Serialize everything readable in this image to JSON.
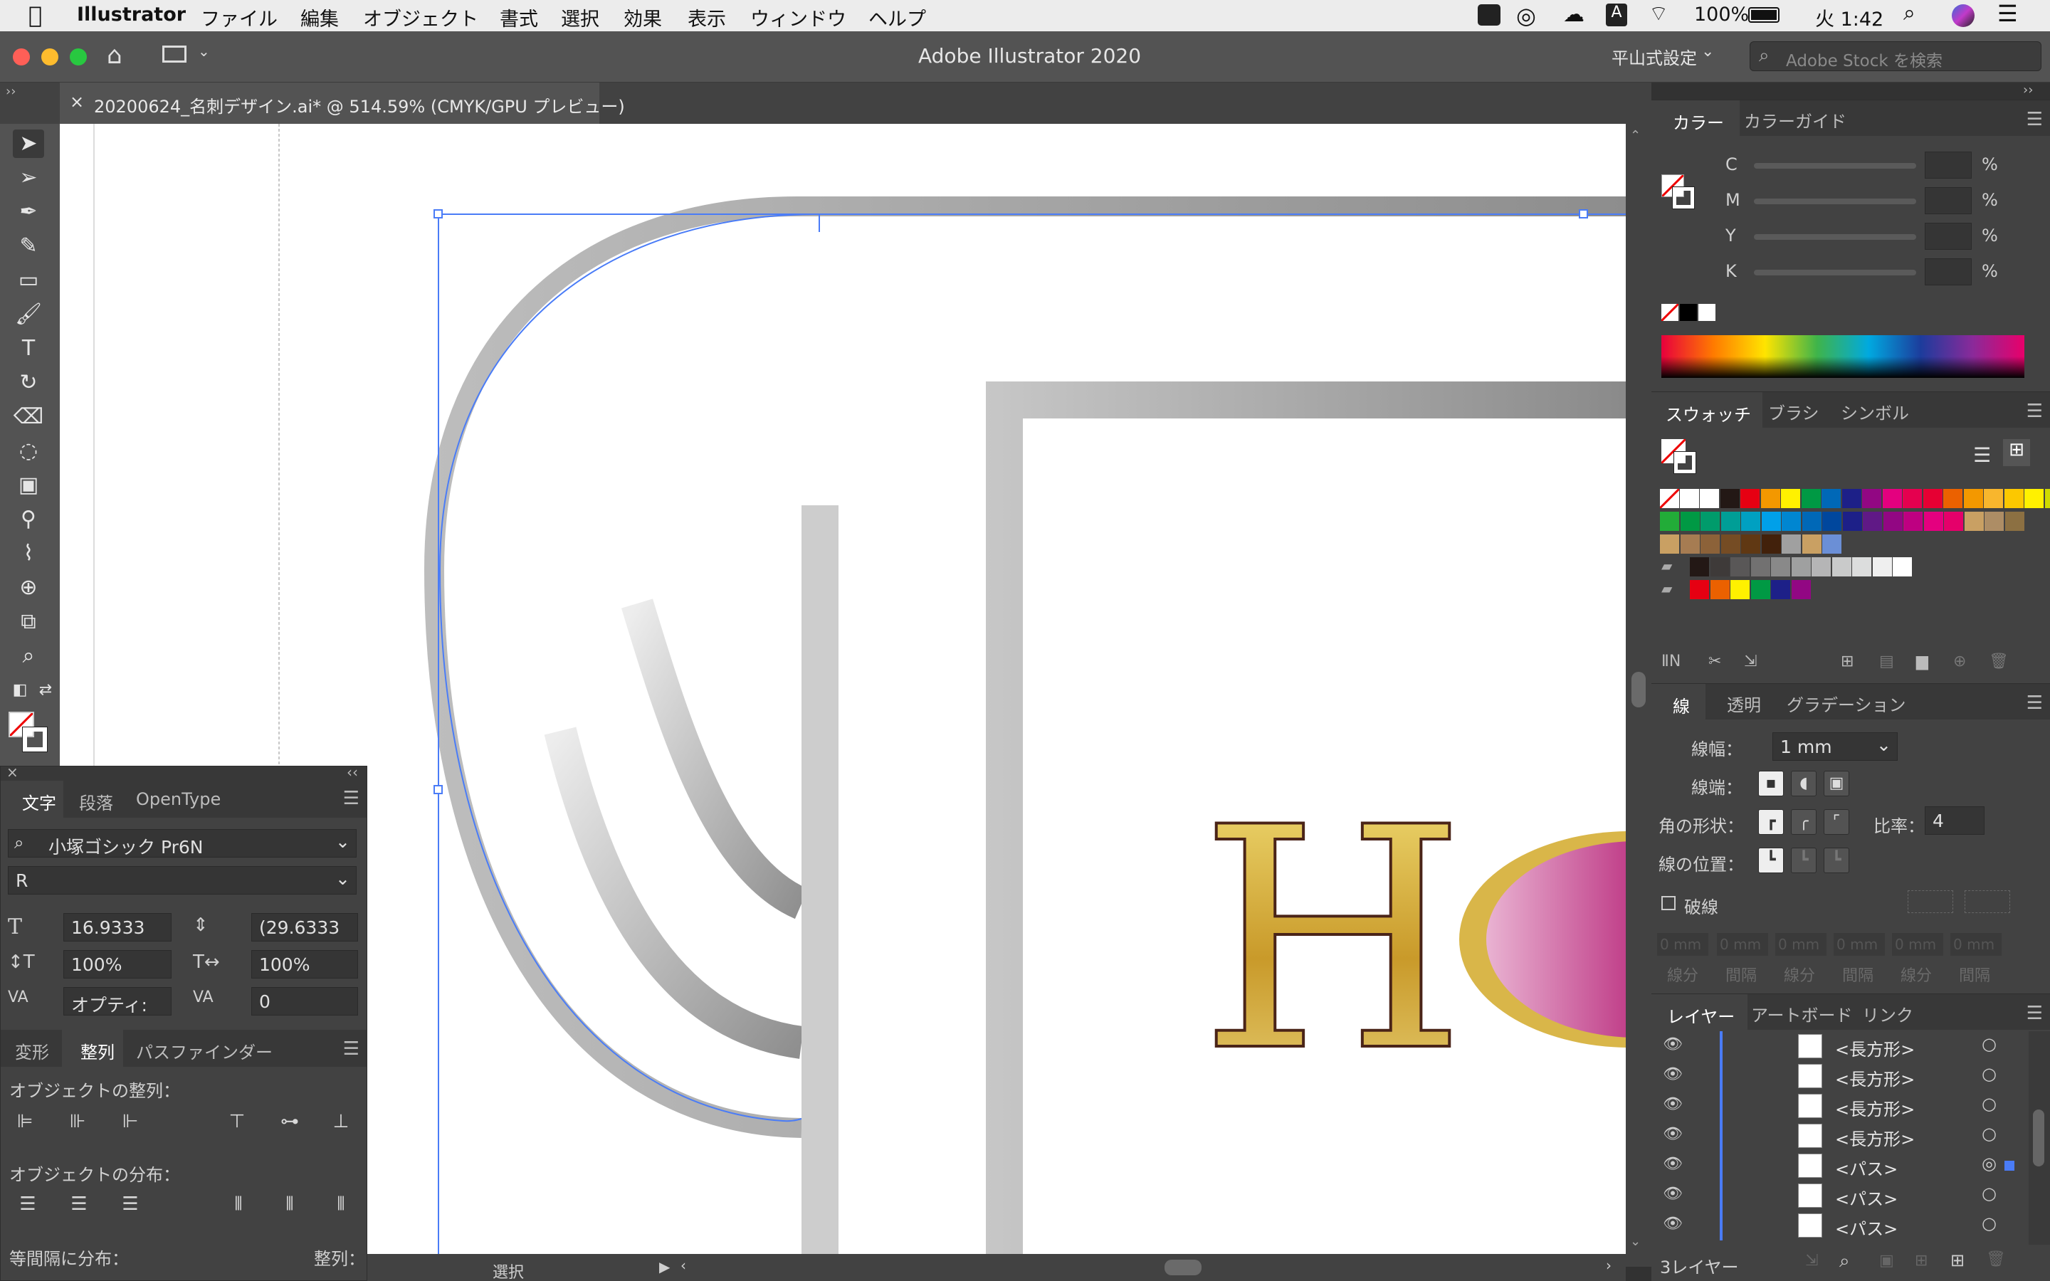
{
  "menubar": {
    "app": "Illustrator",
    "items": [
      "ファイル",
      "編集",
      "オブジェクト",
      "書式",
      "選択",
      "効果",
      "表示",
      "ウィンドウ",
      "ヘルプ"
    ],
    "battery": "100%",
    "clock": "火 1:42",
    "input_method": "A"
  },
  "window": {
    "title": "Adobe Illustrator 2020",
    "workspace": "平山式設定",
    "stock_placeholder": "Adobe Stock を検索"
  },
  "document": {
    "tab_title": "20200624_名刺デザイン.ai* @ 514.59% (CMYK/GPU プレビュー)",
    "close": "×"
  },
  "canvas": {
    "letter_h": "H"
  },
  "status": {
    "mode": "選択"
  },
  "color_panel": {
    "tabs": [
      "カラー",
      "カラーガイド"
    ],
    "channels": [
      "C",
      "M",
      "Y",
      "K"
    ],
    "unit": "%"
  },
  "swatch_panel": {
    "tabs": [
      "スウォッチ",
      "ブラシ",
      "シンボル"
    ],
    "row1": [
      "#ffffff",
      "#231815",
      "#e60012",
      "#f39800",
      "#fff100",
      "#009944",
      "#0068b7",
      "#1d2088",
      "#920783",
      "#e4007f",
      "#e5004f",
      "#e60033",
      "#eb6100",
      "#f39800",
      "#f8b62d",
      "#fcc800",
      "#fff100",
      "#cfdb00",
      "#8fc31f"
    ],
    "row2": [
      "#22ac38",
      "#009944",
      "#009b6b",
      "#009e96",
      "#00a0c1",
      "#00a0e9",
      "#0086d1",
      "#0068b7",
      "#00479d",
      "#1d2088",
      "#601986",
      "#920783",
      "#be0081",
      "#e4007f",
      "#e5006a",
      "#c9a063",
      "#ad8d65",
      "#8c7042"
    ],
    "row3": [
      "#c9a063",
      "#a67c52",
      "#8c6239",
      "#754c24",
      "#603813",
      "#42210b",
      "#a0a0a0",
      "#c9a063",
      "#6b8fd6"
    ],
    "gray": [
      "#231815",
      "#3e3a39",
      "#595757",
      "#727171",
      "#898989",
      "#9fa0a0",
      "#b5b5b6",
      "#c9caca",
      "#dcdddd",
      "#efefef",
      "#ffffff"
    ],
    "bright": [
      "#e60012",
      "#eb6100",
      "#fff100",
      "#009944",
      "#1d2088",
      "#920783"
    ]
  },
  "stroke_panel": {
    "tabs": [
      "線",
      "透明",
      "グラデーション"
    ],
    "weight_label": "線幅：",
    "weight": "1 mm",
    "cap_label": "線端：",
    "corner_label": "角の形状：",
    "limit_label": "比率：",
    "limit": "4",
    "align_label": "線の位置：",
    "dashed_label": "破線",
    "dash_labels": [
      "線分",
      "間隔",
      "線分",
      "間隔",
      "線分",
      "間隔"
    ],
    "dash_placeholder": "0 mm"
  },
  "layers_panel": {
    "tabs": [
      "レイヤー",
      "アートボード",
      "リンク"
    ],
    "rows": [
      "<長方形>",
      "<長方形>",
      "<長方形>",
      "<長方形>",
      "<パス>",
      "<パス>",
      "<パス>"
    ],
    "footer": "3レイヤー"
  },
  "char_panel": {
    "tabs": [
      "文字",
      "段落",
      "OpenType"
    ],
    "font": "小塚ゴシック Pr6N",
    "style": "R",
    "size": "16.9333",
    "leading": "(29.6333",
    "vscale": "100%",
    "hscale": "100%",
    "kerning": "オプティ:",
    "tracking": "0"
  },
  "align_panel": {
    "tabs": [
      "変形",
      "整列",
      "パスファインダー"
    ],
    "align_objects": "オブジェクトの整列：",
    "distribute_objects": "オブジェクトの分布：",
    "distribute_spacing": "等間隔に分布：",
    "align_to": "整列："
  },
  "colors": {
    "selection": "#4a7cf7",
    "menubar": "#ececec",
    "ui_dark": "#424242",
    "magenta": "#b5196e",
    "gold": "#d9b649",
    "brown": "#4a2418"
  }
}
